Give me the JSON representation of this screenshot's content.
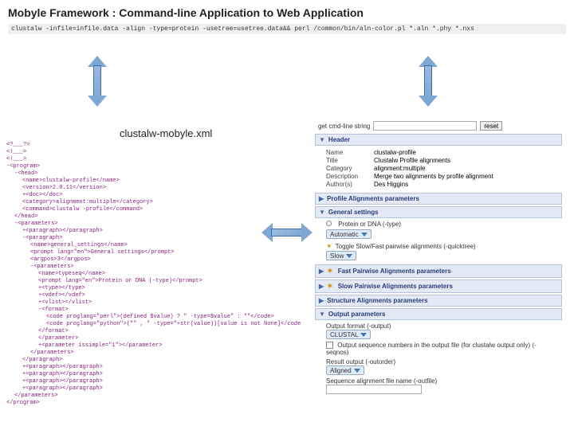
{
  "title": "Mobyle Framework : Command-line Application to Web Application",
  "cmdline": "clustalw -infile=infile.data -align -type=protein -usetree=usetree.data&& perl /common/bin/aln-color.pl *.aln *.phy *.nxs",
  "caption": "clustalw-mobyle.xml",
  "xml": {
    "lines": [
      {
        "i": 0,
        "t": "<?___?>",
        "c": "tag"
      },
      {
        "i": 0,
        "t": "<!___>",
        "c": "tag"
      },
      {
        "i": 0,
        "t": "<!___>",
        "c": "tag"
      },
      {
        "i": 0,
        "t": "-<program>",
        "c": "tag"
      },
      {
        "i": 1,
        "t": "-<head>",
        "c": "tag"
      },
      {
        "i": 2,
        "t": "<name>clustalw-profile</name>",
        "c": "tag"
      },
      {
        "i": 2,
        "t": "<version>2.0.11</version>",
        "c": "tag"
      },
      {
        "i": 2,
        "t": "+<doc></doc>",
        "c": "tag"
      },
      {
        "i": 2,
        "t": "<category>alignment:multiple</category>",
        "c": "tag"
      },
      {
        "i": 2,
        "t": "<command>clustalw -profile</command>",
        "c": "tag"
      },
      {
        "i": 1,
        "t": "</head>",
        "c": "tag"
      },
      {
        "i": 1,
        "t": "-<parameters>",
        "c": "tag"
      },
      {
        "i": 2,
        "t": "+<paragraph></paragraph>",
        "c": "tag"
      },
      {
        "i": 2,
        "t": "-<paragraph>",
        "c": "tag"
      },
      {
        "i": 3,
        "t": "<name>general_settings</name>",
        "c": "tag"
      },
      {
        "i": 3,
        "t": "<prompt lang=\"en\">General settings</prompt>",
        "c": "tag"
      },
      {
        "i": 3,
        "t": "<argpos>3</argpos>",
        "c": "tag"
      },
      {
        "i": 3,
        "t": "-<parameters>",
        "c": "tag"
      },
      {
        "i": 4,
        "t": "<name>typeseq</name>",
        "c": "tag"
      },
      {
        "i": 4,
        "t": "<prompt lang=\"en\">Protein or DNA (-type)</prompt>",
        "c": "tag"
      },
      {
        "i": 4,
        "t": "+<type></type>",
        "c": "tag"
      },
      {
        "i": 4,
        "t": "+<vdef></vdef>",
        "c": "tag"
      },
      {
        "i": 4,
        "t": "+<vlist></vlist>",
        "c": "tag"
      },
      {
        "i": 4,
        "t": "-<format>",
        "c": "tag"
      },
      {
        "i": 5,
        "t": "<code proglang=\"perl\">(defined $value) ? \" -type=$value\" : \"\"</code>",
        "c": "tag"
      },
      {
        "i": 5,
        "t": "<code proglang=\"python\">(\"\" , \" -type=\"+str(value))[value is not None]</code>",
        "c": "tag"
      },
      {
        "i": 4,
        "t": "</format>",
        "c": "tag"
      },
      {
        "i": 4,
        "t": "</parameter>",
        "c": "tag"
      },
      {
        "i": 4,
        "t": "+<parameter issimple=\"1\"></parameter>",
        "c": "tag"
      },
      {
        "i": 3,
        "t": "</parameters>",
        "c": "tag"
      },
      {
        "i": 2,
        "t": "</paragraph>",
        "c": "tag"
      },
      {
        "i": 2,
        "t": "+<paragraph></paragraph>",
        "c": "tag"
      },
      {
        "i": 2,
        "t": "+<paragraph></paragraph>",
        "c": "tag"
      },
      {
        "i": 2,
        "t": "+<paragraph></paragraph>",
        "c": "tag"
      },
      {
        "i": 2,
        "t": "+<paragraph></paragraph>",
        "c": "tag"
      },
      {
        "i": 1,
        "t": "</parameters>",
        "c": "tag"
      },
      {
        "i": 0,
        "t": "</program>",
        "c": "tag"
      }
    ]
  },
  "form": {
    "toprow_label": "get cmd-line string",
    "reset_label": "reset",
    "sections": {
      "header": {
        "title": "Header",
        "open": true
      },
      "profile": {
        "title": "Profile Alignments parameters",
        "open": false
      },
      "general": {
        "title": "General settings",
        "open": true
      },
      "fast": {
        "title": "Fast Pairwise Alignments parameters",
        "open": false
      },
      "slow": {
        "title": "Slow Pairwise Alignments parameters",
        "open": false
      },
      "structure": {
        "title": "Structure Alignments parameters",
        "open": false
      },
      "output": {
        "title": "Output parameters",
        "open": true
      }
    },
    "header_kv": {
      "Name": "clustalw-profile",
      "Title": "Clustalw Profile alignments",
      "Category": "alignment:multiple",
      "Description": "Merge two alignments by profile alignment",
      "Author(s)": "Des Higgins"
    },
    "general": {
      "type_label": "Protein or DNA (-type)",
      "type_value": "Automatic",
      "toggle_label": "Toggle Slow/Fast pairwise alignments (-quicktree)",
      "toggle_value": "Slow"
    },
    "output": {
      "format_label": "Output format (-output)",
      "format_value": "CLUSTAL",
      "seqnos_label": "Output sequence numbers in the output file (for clustalw output only) (-seqnos)",
      "result_label": "Result output (-outorder)",
      "result_value": "Aligned",
      "seqalign_label": "Sequence alignment file name (-outfile)"
    }
  }
}
